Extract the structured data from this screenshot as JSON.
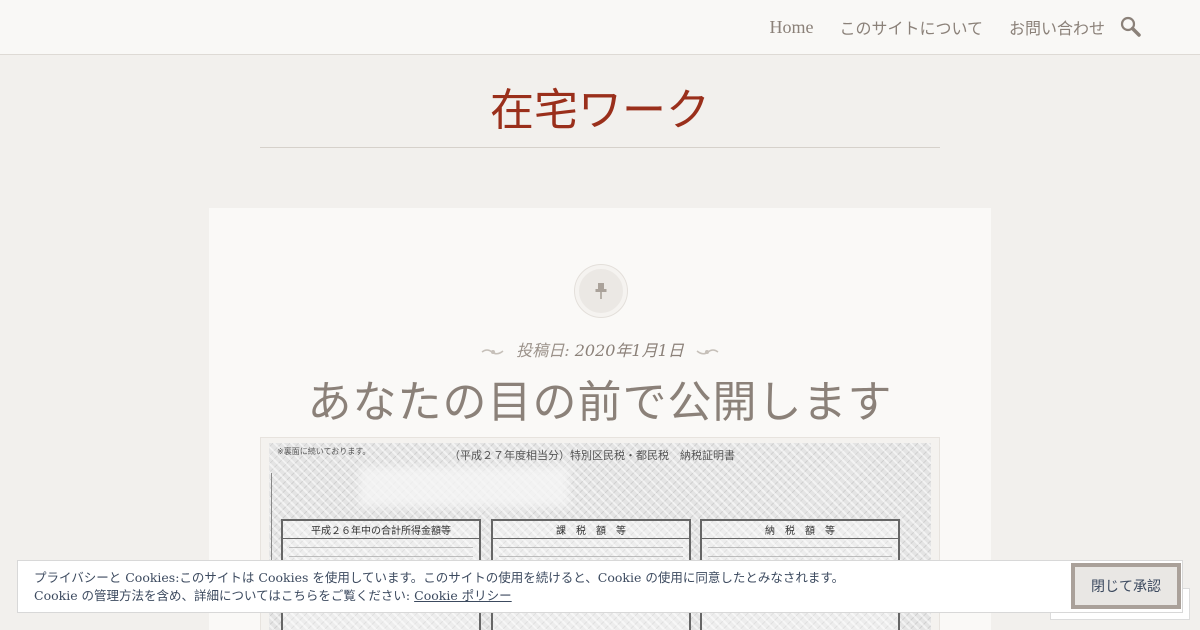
{
  "nav": {
    "items": [
      {
        "label": "Home"
      },
      {
        "label": "このサイトについて"
      },
      {
        "label": "お問い合わせ"
      }
    ],
    "search_icon": "search-icon"
  },
  "site": {
    "title": "在宅ワーク"
  },
  "post": {
    "format_icon": "pushpin-icon",
    "date_label": "投稿日:",
    "date": "2020年1月1日",
    "title": "あなたの目の前で公開します",
    "image": {
      "doc_title": "（平成２７年度相当分）特別区民税・都民税　納税証明書",
      "doc_note": "※裏面に続いております。",
      "boxes": [
        "平成２６年中の合計所得金額等",
        "課　税　額　等",
        "納　税　額　等"
      ]
    }
  },
  "cookie_banner": {
    "line1": "プライバシーと Cookies:このサイトは Cookies を使用しています。このサイトの使用を続けると、Cookie の使用に同意したとみなされます。",
    "line2": "Cookie の管理方法を含め、詳細についてはこちらをご覧ください: ",
    "policy_link": "Cookie ポリシー",
    "accept_button": "閉じて承認"
  },
  "colors": {
    "site_title": "#9a2f1b",
    "text_muted": "#8b8179",
    "background": "#f2f0ed",
    "card": "#faf9f7"
  }
}
